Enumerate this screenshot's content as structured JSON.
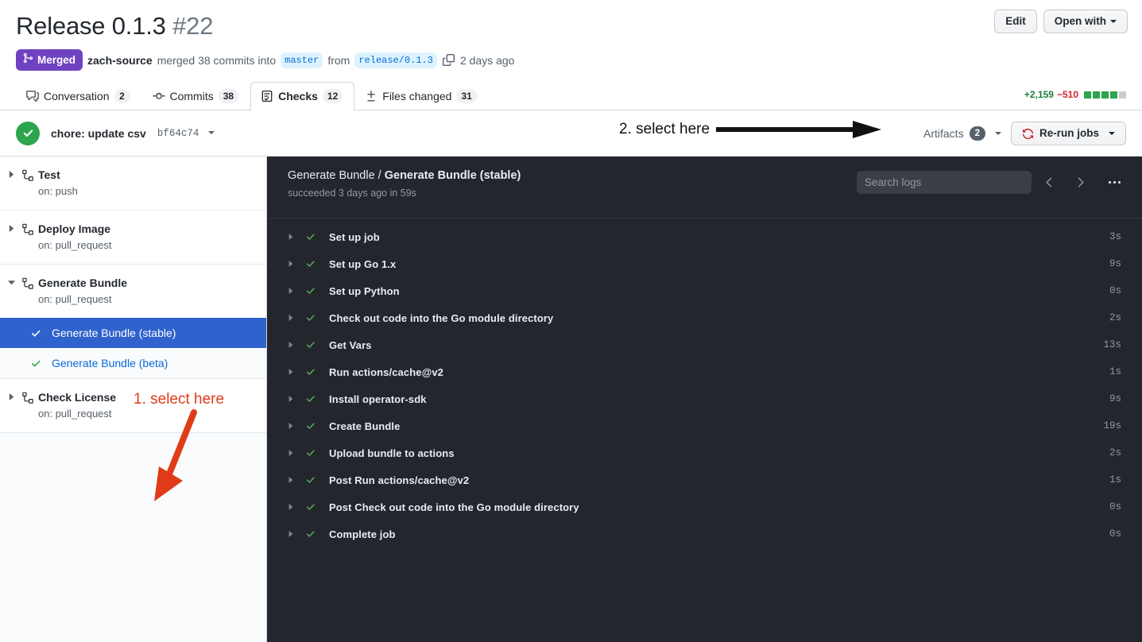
{
  "pr": {
    "title": "Release 0.1.3",
    "number": "#22",
    "state_badge": "Merged",
    "author": "zach-source",
    "merged_text": "merged 38 commits into",
    "base_branch": "master",
    "from_text": "from",
    "head_branch": "release/0.1.3",
    "merged_when": "2 days ago"
  },
  "header_actions": {
    "edit_label": "Edit",
    "open_with_label": "Open with"
  },
  "tabs": [
    {
      "label": "Conversation",
      "count": "2",
      "icon": "comment-discussion-icon",
      "active": false
    },
    {
      "label": "Commits",
      "count": "38",
      "icon": "git-commit-icon",
      "active": false
    },
    {
      "label": "Checks",
      "count": "12",
      "icon": "checklist-icon",
      "active": true
    },
    {
      "label": "Files changed",
      "count": "31",
      "icon": "diff-icon",
      "active": false
    }
  ],
  "diffstat": {
    "additions": "+2,159",
    "deletions": "−510",
    "blocks_on": 4,
    "blocks_off": 1
  },
  "checks_bar": {
    "status_icon": "check-circle-icon",
    "commit_message": "chore: update csv",
    "commit_sha": "bf64c74",
    "artifacts_label": "Artifacts",
    "artifacts_count": "2",
    "rerun_label": "Re-run jobs"
  },
  "annotations": [
    {
      "id": "anno-1",
      "text": "1. select here",
      "color": "#e03b18"
    },
    {
      "id": "anno-2",
      "text": "2. select here",
      "color": "#111111"
    }
  ],
  "sidebar": {
    "workflows": [
      {
        "name": "Test",
        "trigger": "on: push",
        "expanded": false,
        "jobs": []
      },
      {
        "name": "Deploy Image",
        "trigger": "on: pull_request",
        "expanded": false,
        "jobs": []
      },
      {
        "name": "Generate Bundle",
        "trigger": "on: pull_request",
        "expanded": true,
        "jobs": [
          {
            "name": "Generate Bundle (stable)",
            "selected": true,
            "status": "success"
          },
          {
            "name": "Generate Bundle (beta)",
            "selected": false,
            "status": "success"
          }
        ]
      },
      {
        "name": "Check License",
        "trigger": "on: pull_request",
        "expanded": false,
        "jobs": []
      }
    ]
  },
  "log_panel": {
    "workflow_name": "Generate Bundle",
    "separator": "/",
    "job_name": "Generate Bundle (stable)",
    "status_line": "succeeded 3 days ago in 59s",
    "search_placeholder": "Search logs",
    "steps": [
      {
        "name": "Set up job",
        "duration": "3s",
        "status": "success"
      },
      {
        "name": "Set up Go 1.x",
        "duration": "9s",
        "status": "success"
      },
      {
        "name": "Set up Python",
        "duration": "0s",
        "status": "success"
      },
      {
        "name": "Check out code into the Go module directory",
        "duration": "2s",
        "status": "success"
      },
      {
        "name": "Get Vars",
        "duration": "13s",
        "status": "success"
      },
      {
        "name": "Run actions/cache@v2",
        "duration": "1s",
        "status": "success"
      },
      {
        "name": "Install operator-sdk",
        "duration": "9s",
        "status": "success"
      },
      {
        "name": "Create Bundle",
        "duration": "19s",
        "status": "success"
      },
      {
        "name": "Upload bundle to actions",
        "duration": "2s",
        "status": "success"
      },
      {
        "name": "Post Run actions/cache@v2",
        "duration": "1s",
        "status": "success"
      },
      {
        "name": "Post Check out code into the Go module directory",
        "duration": "0s",
        "status": "success"
      },
      {
        "name": "Complete job",
        "duration": "0s",
        "status": "success"
      }
    ]
  },
  "colors": {
    "merged_purple": "#6f42c1",
    "success_green": "#2da44e",
    "selected_blue": "#2f62cc",
    "log_bg": "#24262d",
    "annotation_red": "#e03b18",
    "link_blue": "#0969da"
  }
}
